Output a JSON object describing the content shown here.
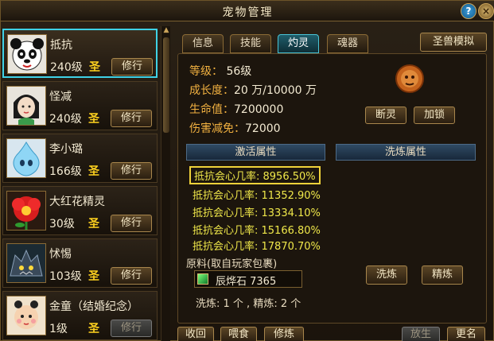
{
  "window": {
    "title": "宠物管理",
    "help_label": "?",
    "close_label": "×"
  },
  "pets": [
    {
      "name": "抵抗",
      "level": "240级",
      "rank": "圣",
      "train_label": "修行",
      "avatar_icon": "panda-avatar-icon"
    },
    {
      "name": "怪减",
      "level": "240级",
      "rank": "圣",
      "train_label": "修行",
      "avatar_icon": "girl-avatar-icon"
    },
    {
      "name": "李小璐",
      "level": "166级",
      "rank": "圣",
      "train_label": "修行",
      "avatar_icon": "ghost-avatar-icon"
    },
    {
      "name": "大红花精灵",
      "level": "30级",
      "rank": "圣",
      "train_label": "修行",
      "avatar_icon": "flower-avatar-icon"
    },
    {
      "name": "怵惕",
      "level": "103级",
      "rank": "圣",
      "train_label": "修行",
      "avatar_icon": "beast-avatar-icon"
    },
    {
      "name": "金童（结婚纪念）",
      "level": "1级",
      "rank": "圣",
      "train_label": "修行",
      "avatar_icon": "boy-avatar-icon"
    }
  ],
  "tabs": [
    {
      "label": "信息",
      "active": false
    },
    {
      "label": "技能",
      "active": false
    },
    {
      "label": "灼灵",
      "active": true
    },
    {
      "label": "魂器",
      "active": false
    }
  ],
  "simulate_label": "圣兽模拟",
  "stats": {
    "level_label": "等级：",
    "level_value": "56级",
    "growth_label": "成长度：",
    "growth_value": "20 万/10000 万",
    "hp_label": "生命值：",
    "hp_value": "7200000",
    "reduce_label": "伤害减免：",
    "reduce_value": "72000"
  },
  "actions": {
    "break_label": "断灵",
    "lock_label": "加锁"
  },
  "activate_header": "激活属性",
  "refine_header": "洗炼属性",
  "attributes": [
    "抵抗会心几率: 8956.50%",
    "抵抗会心几率: 11352.90%",
    "抵抗会心几率: 13334.10%",
    "抵抗会心几率: 15166.80%",
    "抵抗会心几率: 17870.70%"
  ],
  "material": {
    "label": "原料(取自玩家包裹)",
    "item": "辰烨石 7365",
    "wash_label": "洗炼",
    "refine_label": "精炼",
    "counts": "洗炼: 1 个 , 精炼: 2 个"
  },
  "bottom": {
    "recall": "收回",
    "feed": "喂食",
    "cultivate": "修炼",
    "release": "放生",
    "rename": "更名"
  }
}
